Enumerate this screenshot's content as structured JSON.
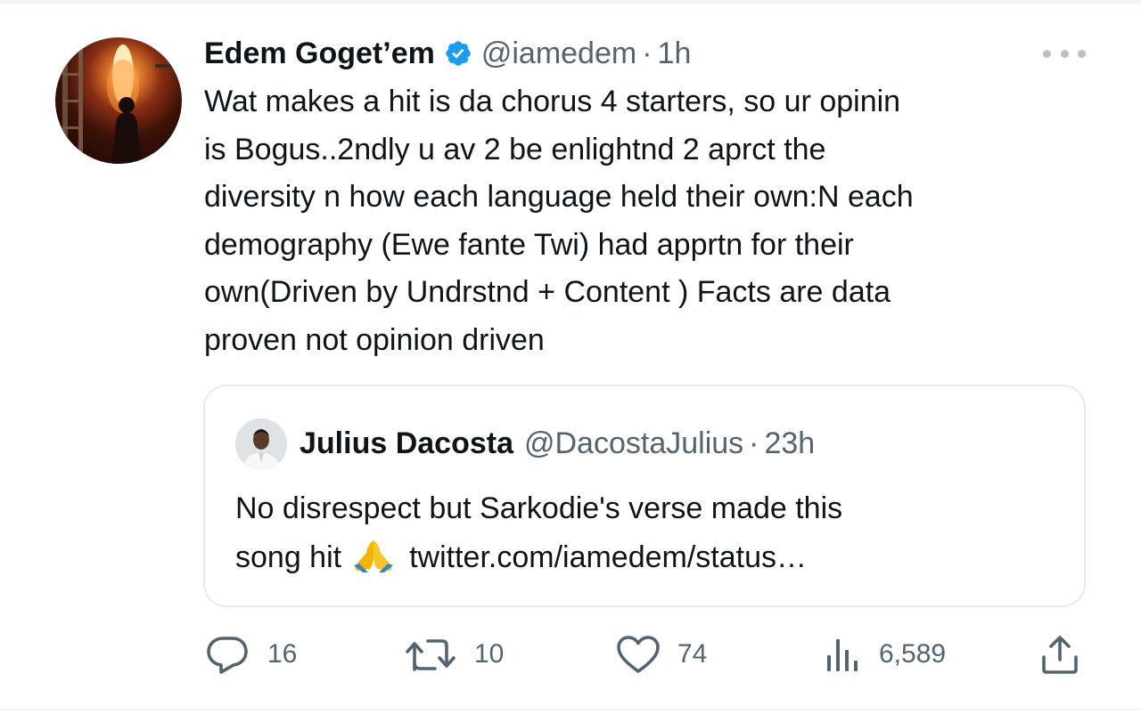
{
  "tweet": {
    "author": {
      "display_name": "Edem Goget’em",
      "handle": "@iamedem",
      "separator": "·",
      "time": "1h",
      "verified": true
    },
    "text_lines": [
      "Wat makes a hit is da chorus 4 starters, so ur opinin",
      "is Bogus..2ndly u av 2 be enlightnd 2 aprct the",
      "diversity n how each language held their own:N each",
      "demography (Ewe fante Twi) had apprtn for their",
      "own(Driven by Undrstnd + Content ) Facts are data",
      "proven not opinion driven"
    ]
  },
  "quoted_tweet": {
    "author": {
      "display_name": "Julius Dacosta",
      "handle": "@DacostaJulius",
      "separator": "·",
      "time": "23h"
    },
    "line1": "No disrespect but Sarkodie's verse made this",
    "line2_start": "song hit",
    "emoji": "folded-hands",
    "link": "twitter.com/iamedem/status…"
  },
  "actions": {
    "reply_count": "16",
    "retweet_count": "10",
    "like_count": "74",
    "views_count": "6,589"
  },
  "icons": {
    "more": "more-horizontal-icon",
    "verified": "verified-badge-icon",
    "reply": "reply-icon",
    "retweet": "retweet-icon",
    "like": "heart-icon",
    "views": "views-chart-icon",
    "share": "share-icon"
  },
  "colors": {
    "text": "#0f1419",
    "secondary": "#536471",
    "verified_blue": "#1d9bf0",
    "border": "#e6ebee"
  }
}
